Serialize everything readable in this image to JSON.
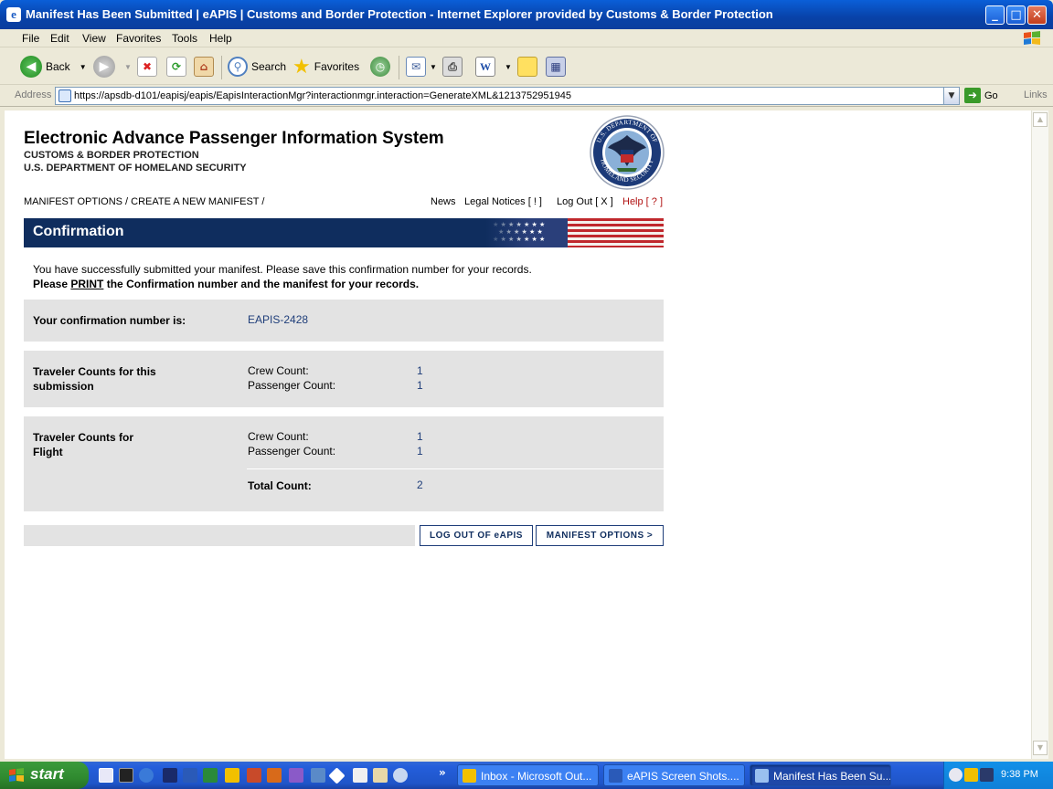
{
  "window": {
    "title": "Manifest Has Been Submitted | eAPIS | Customs and Border Protection - Internet Explorer provided by Customs & Border Protection",
    "controls": [
      "minimize",
      "maximize",
      "close"
    ]
  },
  "menu": [
    "File",
    "Edit",
    "View",
    "Favorites",
    "Tools",
    "Help"
  ],
  "toolbar": {
    "back_label": "Back",
    "search_label": "Search",
    "favorites_label": "Favorites"
  },
  "address": {
    "label": "Address",
    "url": "https://apsdb-d101/eapisj/eapis/EapisInteractionMgr?interactionmgr.interaction=GenerateXML&1213752951945",
    "go_label": "Go",
    "links_label": "Links"
  },
  "page": {
    "header_title": "Electronic Advance Passenger Information System",
    "header_sub1": "CUSTOMS & BORDER PROTECTION",
    "header_sub2": "U.S. DEPARTMENT OF HOMELAND SECURITY",
    "seal_text_top": "U.S. DEPARTMENT OF",
    "seal_text_bottom": "HOMELAND SECURITY",
    "breadcrumb": "MANIFEST OPTIONS / CREATE A NEW MANIFEST /",
    "top_links": {
      "news": "News",
      "legal": "Legal Notices [ ! ]",
      "logout": "Log Out [ X ]",
      "help": "Help [ ? ]"
    },
    "section_title": "Confirmation",
    "message_plain": "You have successfully submitted your manifest. Please save this confirmation number for your records.",
    "message_bold_a": "Please",
    "message_print": "PRINT",
    "message_bold_b": "the Confirmation number and the manifest for your records.",
    "confirmation": {
      "label": "Your confirmation number is:",
      "value": "EAPIS-2428"
    },
    "submission_counts": {
      "label": "Traveler Counts for this submission",
      "crew_label": "Crew Count:",
      "crew_value": "1",
      "passenger_label": "Passenger Count:",
      "passenger_value": "1"
    },
    "flight_counts": {
      "label": "Traveler Counts for Flight",
      "crew_label": "Crew Count:",
      "crew_value": "1",
      "passenger_label": "Passenger Count:",
      "passenger_value": "1",
      "total_label": "Total Count:",
      "total_value": "2"
    },
    "buttons": {
      "logout": "LOG OUT OF eAPIS",
      "manifest_options": "MANIFEST OPTIONS >"
    }
  },
  "taskbar": {
    "start_label": "start",
    "tasks": [
      "Inbox - Microsoft Out...",
      "eAPIS Screen Shots....",
      "Manifest Has Been Su..."
    ],
    "clock": "9:38 PM"
  },
  "colors": {
    "navy": "#0f2d5e",
    "value_blue": "#1f3e7a",
    "help_red": "#b01010",
    "panel_grey": "#e3e3e3"
  }
}
